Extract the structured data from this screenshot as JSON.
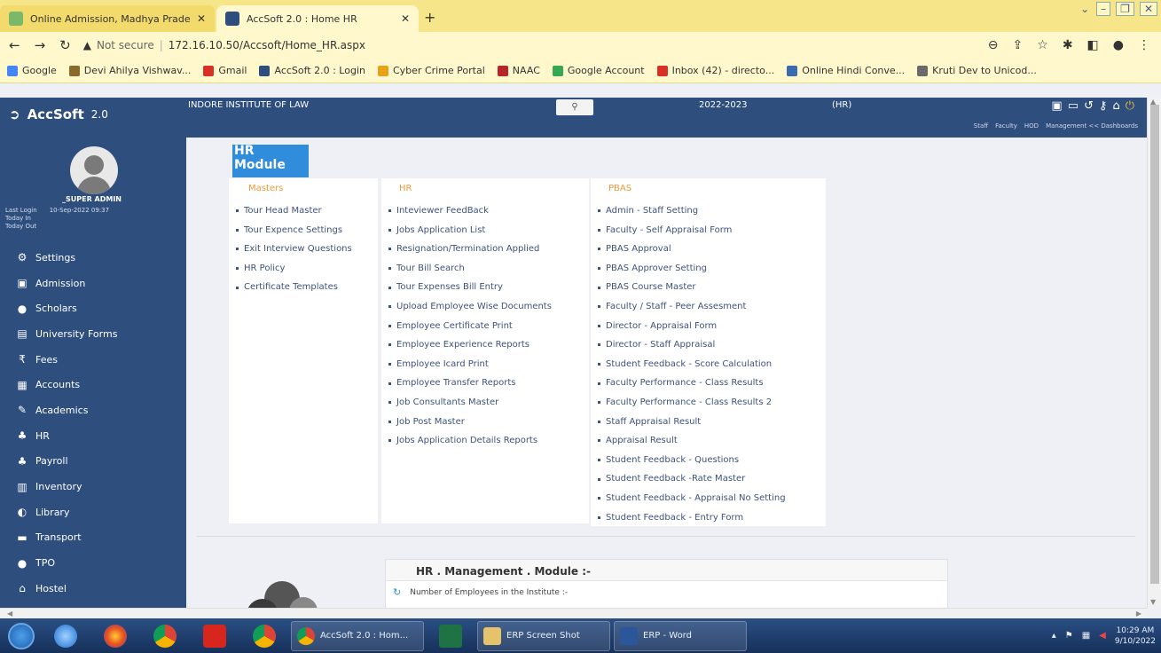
{
  "browser": {
    "tabs": [
      {
        "title": "Online Admission, Madhya Prade",
        "active": false
      },
      {
        "title": "AccSoft 2.0 : Home HR",
        "active": true
      }
    ],
    "new_tab": "+",
    "url_prefix": "Not secure",
    "url": "172.16.10.50/Accsoft/Home_HR.aspx",
    "bookmarks": [
      "Google",
      "Devi Ahilya Vishwav...",
      "Gmail",
      "AccSoft 2.0 : Login",
      "Cyber Crime Portal",
      "NAAC",
      "Google Account",
      "Inbox (42) - directo...",
      "Online Hindi Conve...",
      "Kruti Dev to Unicod..."
    ]
  },
  "header": {
    "logo": "AccSoft",
    "version": "2.0",
    "institute": "INDORE INSTITUTE OF LAW",
    "year": "2022-2023",
    "role": "(HR)",
    "links": [
      "Staff",
      "Faculty",
      "HOD",
      "Management << Dashboards"
    ]
  },
  "user": {
    "name": "_SUPER ADMIN",
    "last_login_label": "Last Login",
    "last_login_value": "10-Sep-2022 09:37",
    "today_in": "Today In",
    "today_out": "Today Out"
  },
  "sidebar": {
    "items": [
      {
        "label": "Settings",
        "icon": "gear-icon",
        "glyph": "⚙"
      },
      {
        "label": "Admission",
        "icon": "id-card-icon",
        "glyph": "▣"
      },
      {
        "label": "Scholars",
        "icon": "user-icon",
        "glyph": "●"
      },
      {
        "label": "University Forms",
        "icon": "form-icon",
        "glyph": "▤"
      },
      {
        "label": "Fees",
        "icon": "rupee-icon",
        "glyph": "₹"
      },
      {
        "label": "Accounts",
        "icon": "calculator-icon",
        "glyph": "▦"
      },
      {
        "label": "Academics",
        "icon": "pencil-icon",
        "glyph": "✎"
      },
      {
        "label": "HR",
        "icon": "users-icon",
        "glyph": "♣"
      },
      {
        "label": "Payroll",
        "icon": "payroll-icon",
        "glyph": "♣"
      },
      {
        "label": "Inventory",
        "icon": "inventory-icon",
        "glyph": "▥"
      },
      {
        "label": "Library",
        "icon": "library-icon",
        "glyph": "◐"
      },
      {
        "label": "Transport",
        "icon": "bus-icon",
        "glyph": "▬"
      },
      {
        "label": "TPO",
        "icon": "tpo-icon",
        "glyph": "●"
      },
      {
        "label": "Hostel",
        "icon": "home-icon",
        "glyph": "⌂"
      }
    ]
  },
  "main": {
    "module_title": "HR Module",
    "columns": [
      {
        "heading": "Masters",
        "items": [
          "Tour Head Master",
          "Tour Expence Settings",
          "Exit Interview Questions",
          "HR Policy",
          "Certificate Templates"
        ]
      },
      {
        "heading": "HR",
        "items": [
          "Inteviewer FeedBack",
          "Jobs Application List",
          "Resignation/Termination Applied",
          "Tour Bill Search",
          "Tour Expenses Bill Entry",
          "Upload Employee Wise Documents",
          "Employee Certificate Print",
          "Employee Experience Reports",
          "Employee Icard Print",
          "Employee Transfer Reports",
          "Job Consultants Master",
          "Job Post Master",
          "Jobs Application Details Reports"
        ]
      },
      {
        "heading": "PBAS",
        "items": [
          "Admin - Staff Setting",
          "Faculty - Self Appraisal Form",
          "PBAS Approval",
          "PBAS Approver Setting",
          "PBAS Course Master",
          "Faculty / Staff - Peer Assesment",
          "Director - Appraisal Form",
          "Director - Staff Appraisal",
          "Student Feedback - Score Calculation",
          "Faculty Performance - Class Results",
          "Faculty Performance - Class Results 2",
          "Staff Appraisal Result",
          "Appraisal Result",
          "Student Feedback - Questions",
          "Student Feedback -Rate Master",
          "Student Feedback - Appraisal No Setting",
          "Student Feedback - Entry Form"
        ]
      }
    ],
    "management": {
      "title": "HR . Management . Module :-",
      "row1": "Number of Employees in the Institute :-"
    }
  },
  "taskbar": {
    "items": [
      {
        "label": "AccSoft 2.0 : Hom...",
        "icon": "chrome-icon"
      },
      {
        "label": "ERP Screen Shot",
        "icon": "folder-icon"
      },
      {
        "label": "ERP - Word",
        "icon": "word-icon"
      }
    ],
    "time": "10:29 AM",
    "date": "9/10/2022"
  },
  "colors": {
    "header_bg": "#2e4e7e",
    "accent": "#2f8ddc",
    "column_heading": "#f0973a"
  }
}
